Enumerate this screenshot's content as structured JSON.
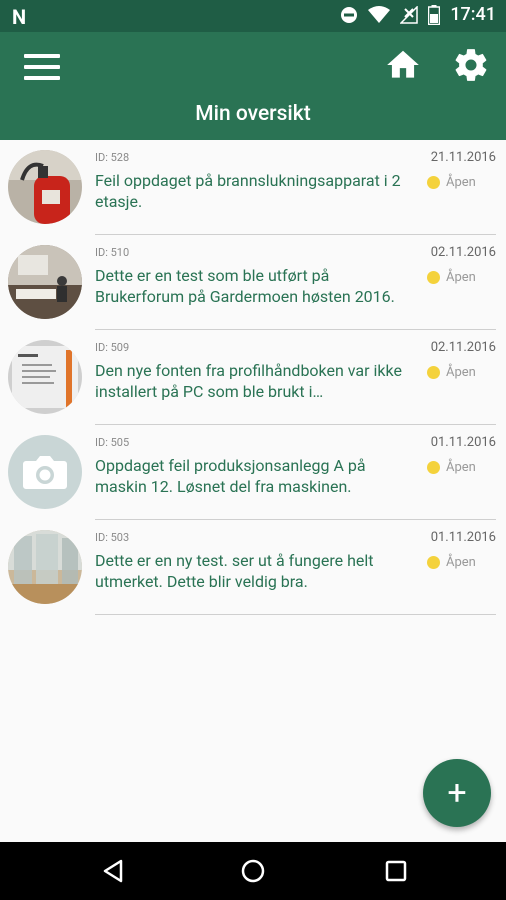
{
  "status_bar": {
    "carrier_glyph": "N",
    "time": "17:41",
    "icons": [
      "do-not-disturb-icon",
      "wifi-icon",
      "no-signal-icon",
      "battery-icon"
    ]
  },
  "app_bar": {
    "title": "Min oversikt",
    "icons": [
      "menu-icon",
      "home-icon",
      "gear-icon"
    ]
  },
  "colors": {
    "primary": "#2a7354",
    "status_bar": "#1f5d45",
    "status_dot": "#f4d23c"
  },
  "items": [
    {
      "id": "ID: 528",
      "date": "21.11.2016",
      "description": "Feil oppdaget på brannslukningsapparat i 2 etasje.",
      "status": "Åpen",
      "thumbnail": "fire-extinguisher-photo"
    },
    {
      "id": "ID: 510",
      "date": "02.11.2016",
      "description": "Dette er en test som ble utført på Brukerforum på Gardermoen høsten 2016.",
      "status": "Åpen",
      "thumbnail": "meeting-room-photo"
    },
    {
      "id": "ID: 509",
      "date": "02.11.2016",
      "description": "Den nye fonten fra profilhåndboken var ikke installert på PC som ble brukt i presentasjonen.",
      "status": "Åpen",
      "thumbnail": "presentation-slide-photo"
    },
    {
      "id": "ID: 505",
      "date": "01.11.2016",
      "description": "Oppdaget feil produksjonsanlegg A på maskin 12. Løsnet del fra maskinen.",
      "status": "Åpen",
      "thumbnail": "camera-placeholder"
    },
    {
      "id": "ID: 503",
      "date": "01.11.2016",
      "description": "Dette er en ny test. ser ut å fungere helt utmerket. Dette blir veldig bra.",
      "status": "Åpen",
      "thumbnail": "glass-office-photo"
    }
  ],
  "fab": {
    "label": "+"
  }
}
